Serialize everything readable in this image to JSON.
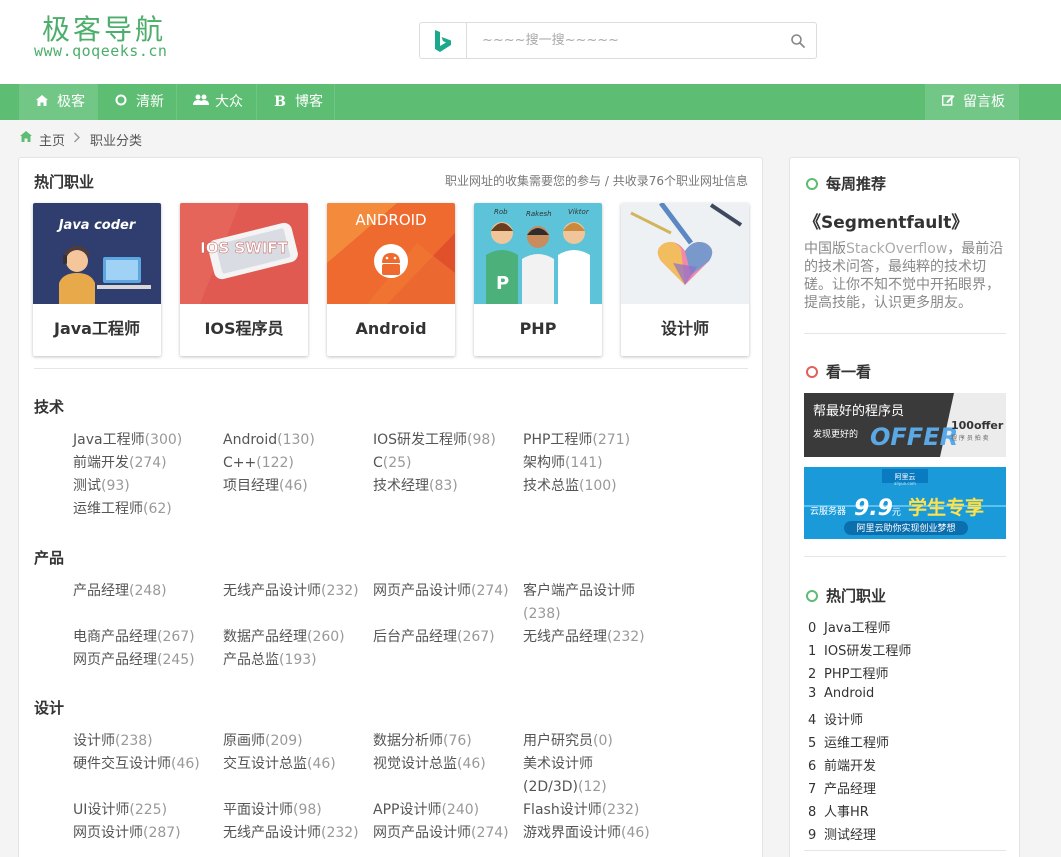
{
  "logo": {
    "cn": "极客导航",
    "en": "www.qoqeeks.cn"
  },
  "search": {
    "placeholder": "~~~~搜一搜~~~~~"
  },
  "nav": {
    "items": [
      {
        "label": "极客",
        "icon": "home-icon"
      },
      {
        "label": "清新",
        "icon": "circle-icon"
      },
      {
        "label": "大众",
        "icon": "users-icon"
      },
      {
        "label": "博客",
        "icon": "bold-b-icon"
      }
    ],
    "guestbook": "留言板"
  },
  "breadcrumb": {
    "home": "主页",
    "current": "职业分类"
  },
  "main": {
    "title": "热门职业",
    "info": "职业网址的收集需要您的参与 / 共收录76个职业网址信息",
    "cards": [
      {
        "name": "Java工程师",
        "caption": "Java coder"
      },
      {
        "name": "IOS程序员",
        "caption": "IOS SWIFT"
      },
      {
        "name": "Android",
        "caption": "ANDROID"
      },
      {
        "name": "PHP",
        "caption": ""
      },
      {
        "name": "设计师",
        "caption": ""
      }
    ],
    "person_labels": [
      "Rob",
      "Rakesh",
      "Viktor"
    ],
    "categories": [
      {
        "title": "技术",
        "links": [
          {
            "name": "Java工程师",
            "count": "(300)"
          },
          {
            "name": "Android",
            "count": "(130)"
          },
          {
            "name": "IOS研发工程师",
            "count": "(98)"
          },
          {
            "name": "PHP工程师",
            "count": "(271)"
          },
          {
            "name": "前端开发",
            "count": "(274)"
          },
          {
            "name": "C++",
            "count": "(122)"
          },
          {
            "name": "C",
            "count": "(25)"
          },
          {
            "name": "架构师",
            "count": "(141)"
          },
          {
            "name": "测试",
            "count": "(93)"
          },
          {
            "name": "项目经理",
            "count": "(46)"
          },
          {
            "name": "技术经理",
            "count": "(83)"
          },
          {
            "name": "技术总监",
            "count": "(100)"
          },
          {
            "name": "运维工程师",
            "count": "(62)"
          }
        ]
      },
      {
        "title": "产品",
        "links": [
          {
            "name": "产品经理",
            "count": "(248)"
          },
          {
            "name": "无线产品设计师",
            "count": "(232)"
          },
          {
            "name": "网页产品设计师",
            "count": "(274)"
          },
          {
            "name": "客户端产品设计师",
            "count": "(238)"
          },
          {
            "name": "电商产品经理",
            "count": "(267)"
          },
          {
            "name": "数据产品经理",
            "count": "(260)"
          },
          {
            "name": "后台产品经理",
            "count": "(267)"
          },
          {
            "name": "无线产品经理",
            "count": "(232)"
          },
          {
            "name": "网页产品经理",
            "count": "(245)"
          },
          {
            "name": "产品总监",
            "count": "(193)"
          }
        ]
      },
      {
        "title": "设计",
        "links": [
          {
            "name": "设计师",
            "count": "(238)"
          },
          {
            "name": "原画师",
            "count": "(209)"
          },
          {
            "name": "数据分析师",
            "count": "(76)"
          },
          {
            "name": "用户研究员",
            "count": "(0)"
          },
          {
            "name": "硬件交互设计师",
            "count": "(46)"
          },
          {
            "name": "交互设计总监",
            "count": "(46)"
          },
          {
            "name": "视觉设计总监",
            "count": "(46)"
          },
          {
            "name": "美术设计师(2D/3D)",
            "count": "(12)"
          },
          {
            "name": "UI设计师",
            "count": "(225)"
          },
          {
            "name": "平面设计师",
            "count": "(98)"
          },
          {
            "name": "APP设计师",
            "count": "(240)"
          },
          {
            "name": "Flash设计师",
            "count": "(232)"
          },
          {
            "name": "网页设计师",
            "count": "(287)"
          },
          {
            "name": "无线产品设计师",
            "count": "(232)"
          },
          {
            "name": "网页产品设计师",
            "count": "(274)"
          },
          {
            "name": "游戏界面设计师",
            "count": "(46)"
          }
        ]
      }
    ]
  },
  "sidebar": {
    "weekly": {
      "title": "每周推荐",
      "site": "《Segmentfault》",
      "desc_prefix": "中国版",
      "desc_highlight": "StackOverflow",
      "desc_rest": "，最前沿的技术问答，最纯粹的技术切磋。让你不知不觉中开拓眼界，提高技能，认识更多朋友。"
    },
    "look": {
      "title": "看一看",
      "ad1": {
        "line1": "帮最好的程序员",
        "line2": "发现更好的",
        "offer": "OFFER",
        "brand": "100offer",
        "brand_sub": "程 序 员 拍 卖"
      },
      "ad2": {
        "brand": "阿里云",
        "brand_en": "aliyun.com",
        "label": "云服务器",
        "price": "9.9",
        "unit": "元",
        "slogan": "学生专享",
        "sub": "阿里云助你实现创业梦想"
      }
    },
    "hot": {
      "title": "热门职业",
      "items": [
        "Java工程师",
        "IOS研发工程师",
        "PHP工程师",
        "Android",
        "设计师",
        "运维工程师",
        "前端开发",
        "产品经理",
        "人事HR",
        "测试经理"
      ]
    }
  },
  "colors": {
    "accent": "#5cbd73",
    "accent_light": "#72c787",
    "count": "#999999"
  }
}
